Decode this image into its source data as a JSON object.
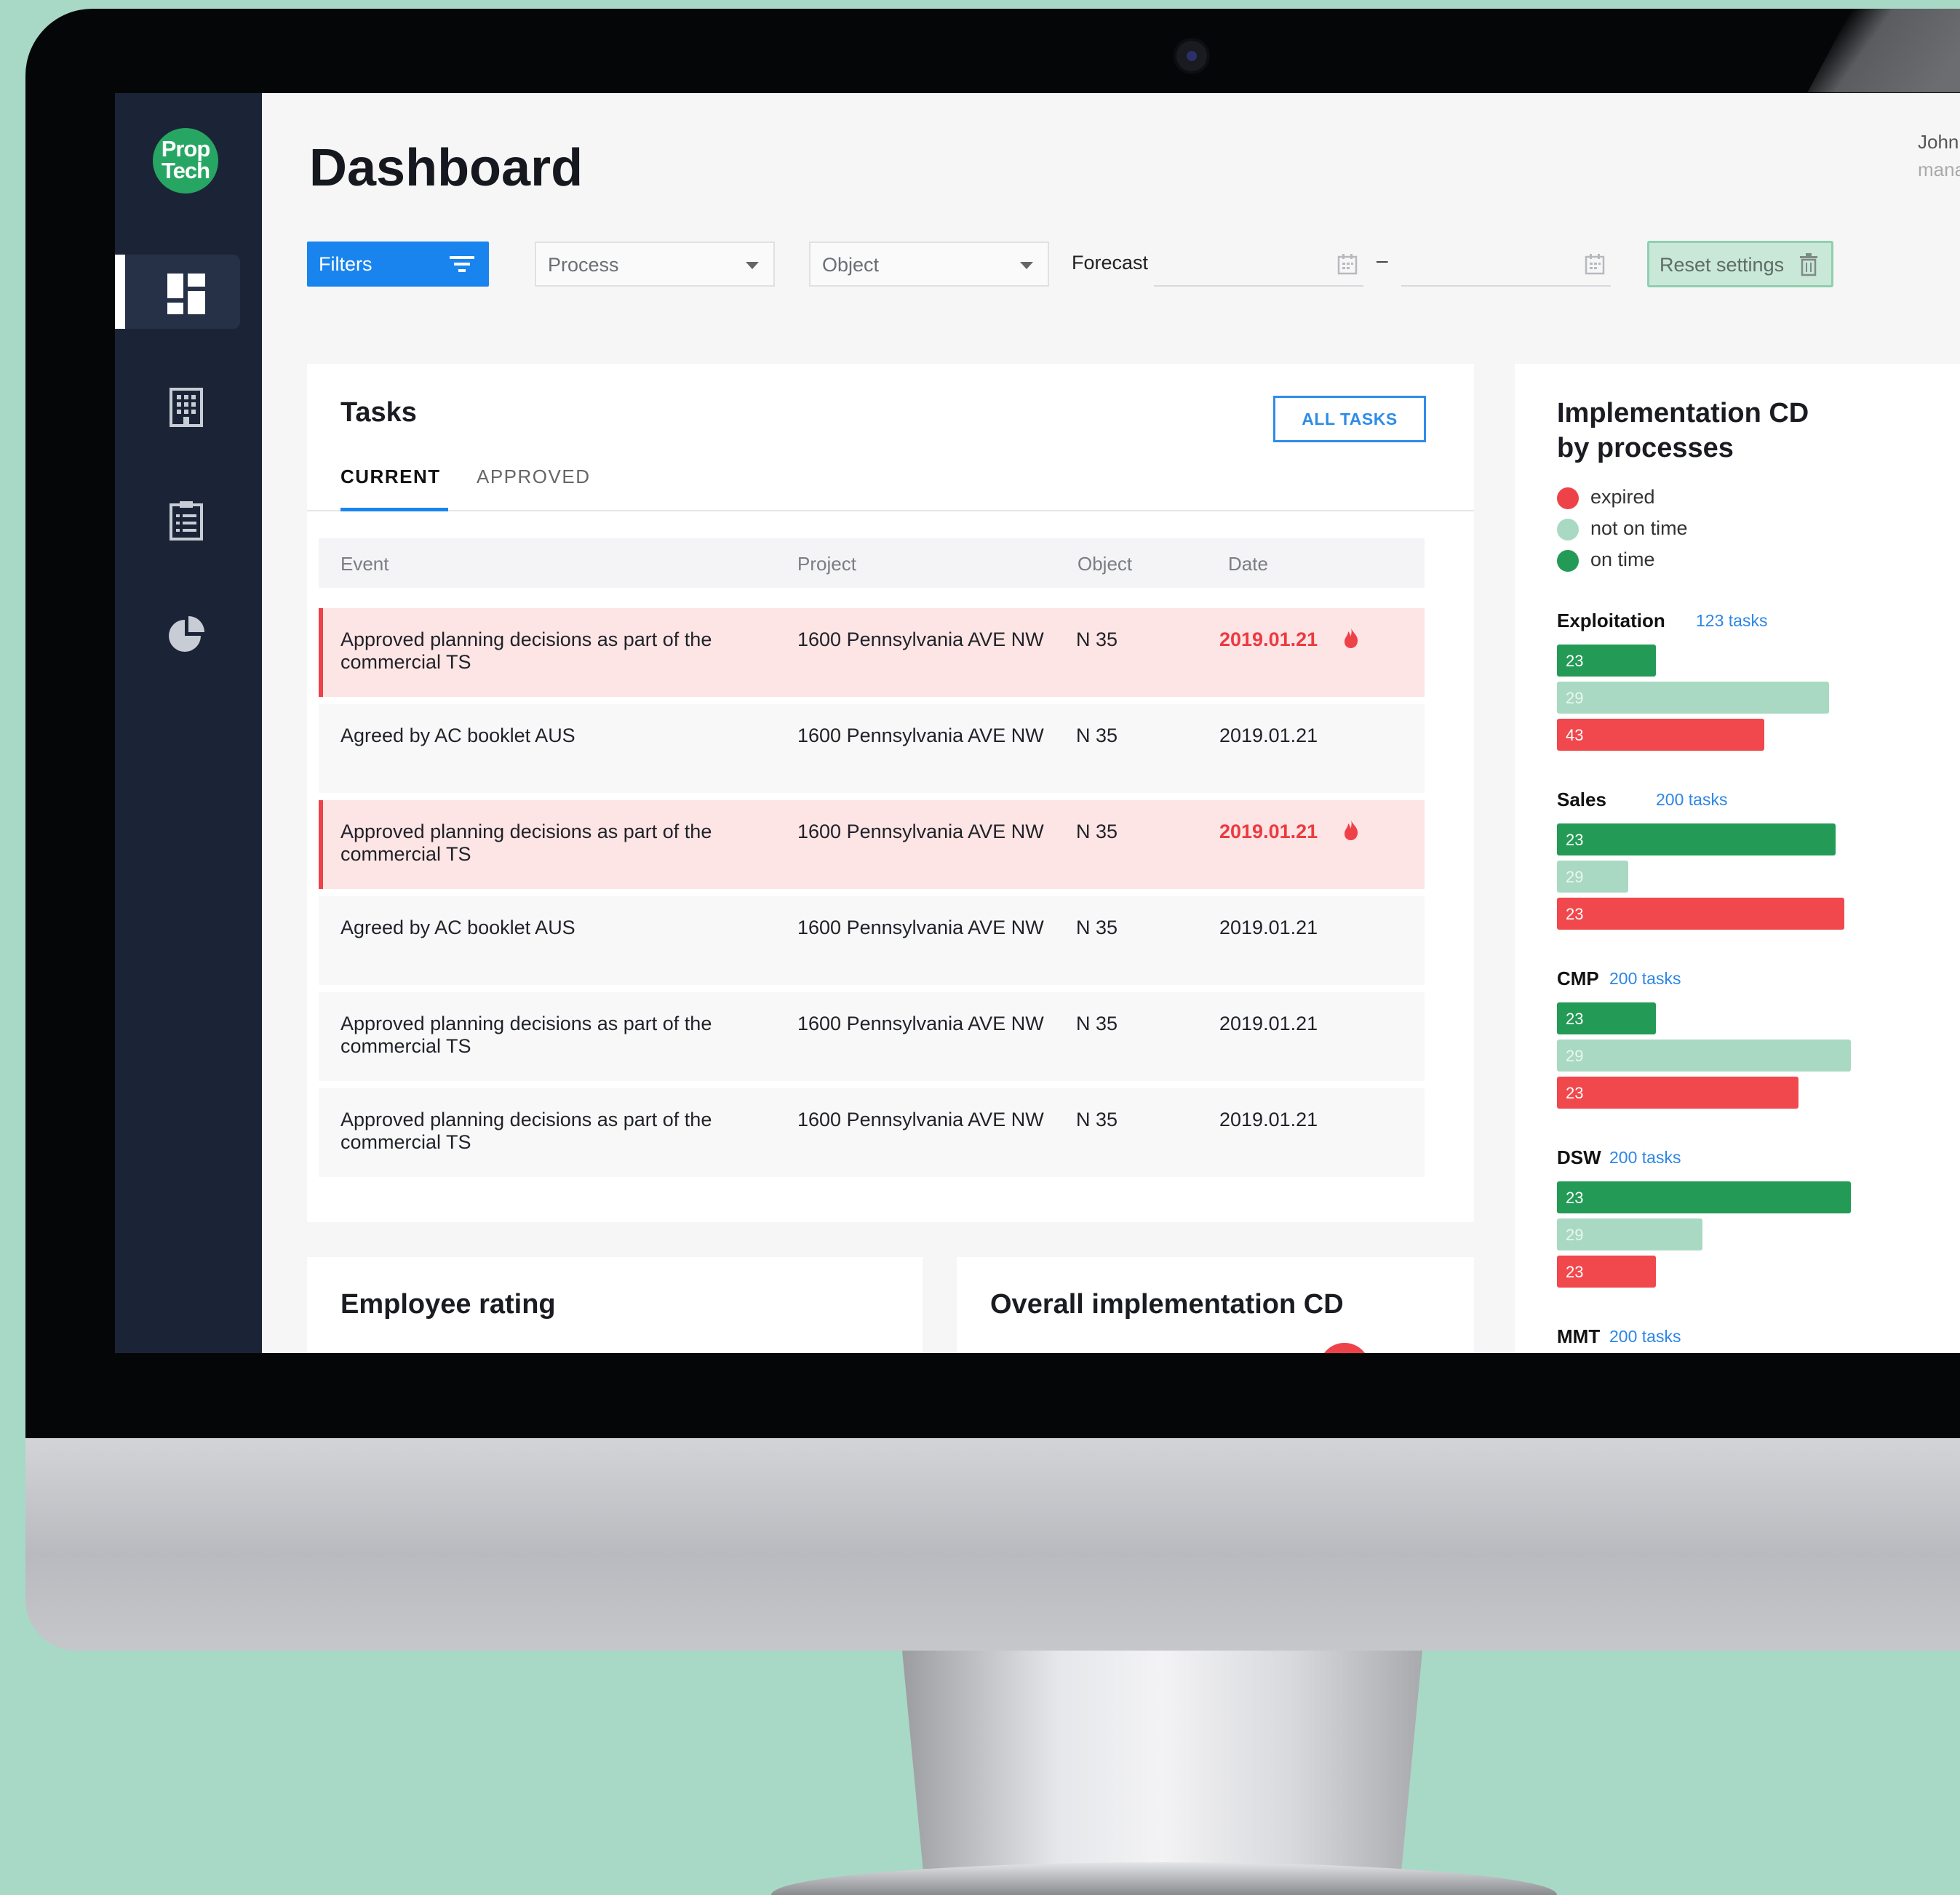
{
  "app": {
    "logo_line1": "Prop",
    "logo_line2": "Tech",
    "title": "Dashboard"
  },
  "user": {
    "name": "John",
    "role": "mana"
  },
  "nav": [
    {
      "icon": "dashboard-icon",
      "active": true
    },
    {
      "icon": "building-icon",
      "active": false
    },
    {
      "icon": "clipboard-list-icon",
      "active": false
    },
    {
      "icon": "pie-chart-icon",
      "active": false
    }
  ],
  "filters": {
    "filters_label": "Filters",
    "process_label": "Process",
    "object_label": "Object",
    "forecast_label": "Forecast",
    "forecast_from": "",
    "forecast_to": "",
    "date_separator": "–",
    "reset_label": "Reset settings"
  },
  "tasks": {
    "title": "Tasks",
    "all_tasks_label": "ALL TASKS",
    "tabs": [
      {
        "label": "CURRENT",
        "active": true
      },
      {
        "label": "APPROVED",
        "active": false
      }
    ],
    "columns": [
      "Event",
      "Project",
      "Object",
      "Date"
    ],
    "rows": [
      {
        "event": "Approved planning decisions as part of the commercial TS",
        "project": "1600 Pennsylvania AVE NW",
        "object": "N 35",
        "date": "2019.01.21",
        "overdue": true
      },
      {
        "event": "Agreed by AC booklet AUS",
        "project": "1600 Pennsylvania AVE NW",
        "object": "N 35",
        "date": "2019.01.21",
        "overdue": false
      },
      {
        "event": "Approved planning decisions as part of the commercial TS",
        "project": "1600 Pennsylvania AVE NW",
        "object": "N 35",
        "date": "2019.01.21",
        "overdue": true
      },
      {
        "event": "Agreed by AC booklet AUS",
        "project": "1600 Pennsylvania AVE NW",
        "object": "N 35",
        "date": "2019.01.21",
        "overdue": false
      },
      {
        "event": "Approved planning decisions as part of the commercial TS",
        "project": "1600 Pennsylvania AVE NW",
        "object": "N 35",
        "date": "2019.01.21",
        "overdue": false
      },
      {
        "event": "Approved planning decisions as part of the commercial TS",
        "project": "1600 Pennsylvania AVE NW",
        "object": "N 35",
        "date": "2019.01.21",
        "overdue": false
      }
    ]
  },
  "employee_rating": {
    "title": "Employee rating"
  },
  "overall": {
    "title": "Overall implementation CD"
  },
  "implementation": {
    "title_line1": "Implementation CD",
    "title_line2": "by processes",
    "legend": [
      {
        "label": "expired",
        "color": "#ee4249"
      },
      {
        "label": "not on time",
        "color": "#a9d9c2"
      },
      {
        "label": "on time",
        "color": "#239a55"
      }
    ],
    "groups": [
      {
        "name": "Exploitation",
        "count": "123 tasks",
        "on_time": "23",
        "not_on_time": "29",
        "expired": "43",
        "on_time_pct": 0.32,
        "not_on_time_pct": 0.88,
        "expired_pct": 0.67
      },
      {
        "name": "Sales",
        "count": "200 tasks",
        "on_time": "23",
        "not_on_time": "29",
        "expired": "23",
        "on_time_pct": 0.9,
        "not_on_time_pct": 0.23,
        "expired_pct": 0.93
      },
      {
        "name": "CMP",
        "count": "200 tasks",
        "on_time": "23",
        "not_on_time": "29",
        "expired": "23",
        "on_time_pct": 0.32,
        "not_on_time_pct": 0.95,
        "expired_pct": 0.78
      },
      {
        "name": "DSW",
        "count": "200 tasks",
        "on_time": "23",
        "not_on_time": "29",
        "expired": "23",
        "on_time_pct": 0.95,
        "not_on_time_pct": 0.47,
        "expired_pct": 0.32
      },
      {
        "name": "MMT",
        "count": "200 tasks"
      }
    ]
  }
}
